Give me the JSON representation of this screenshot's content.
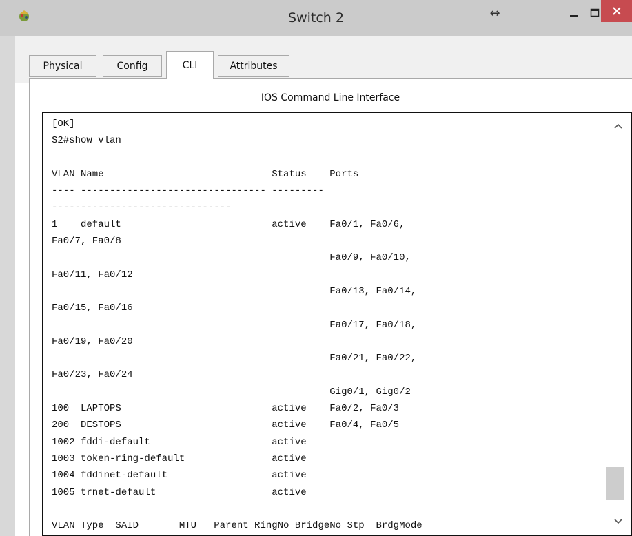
{
  "window": {
    "title": "Switch 2",
    "resize_glyph": "↔",
    "icons": {
      "app": "packet-tracer-icon",
      "minimize": "minimize-icon",
      "maximize": "maximize-icon",
      "close": "close-icon"
    },
    "colors": {
      "close_button": "#c74b50",
      "titlebar": "#cbcbcb"
    }
  },
  "tabs": [
    {
      "label": "Physical",
      "active": false
    },
    {
      "label": "Config",
      "active": false
    },
    {
      "label": "CLI",
      "active": true
    },
    {
      "label": "Attributes",
      "active": false
    }
  ],
  "cli": {
    "panel_title": "IOS Command Line Interface",
    "lines": [
      "[OK]",
      "S2#show vlan",
      "",
      "VLAN Name                             Status    Ports",
      "---- -------------------------------- ---------",
      "-------------------------------",
      "1    default                          active    Fa0/1, Fa0/6,",
      "Fa0/7, Fa0/8",
      "                                                Fa0/9, Fa0/10,",
      "Fa0/11, Fa0/12",
      "                                                Fa0/13, Fa0/14,",
      "Fa0/15, Fa0/16",
      "                                                Fa0/17, Fa0/18,",
      "Fa0/19, Fa0/20",
      "                                                Fa0/21, Fa0/22,",
      "Fa0/23, Fa0/24",
      "                                                Gig0/1, Gig0/2",
      "100  LAPTOPS                          active    Fa0/2, Fa0/3",
      "200  DESTOPS                          active    Fa0/4, Fa0/5",
      "1002 fddi-default                     active",
      "1003 token-ring-default               active",
      "1004 fddinet-default                  active",
      "1005 trnet-default                    active",
      "",
      "VLAN Type  SAID       MTU   Parent RingNo BridgeNo Stp  BrdgMode"
    ]
  }
}
